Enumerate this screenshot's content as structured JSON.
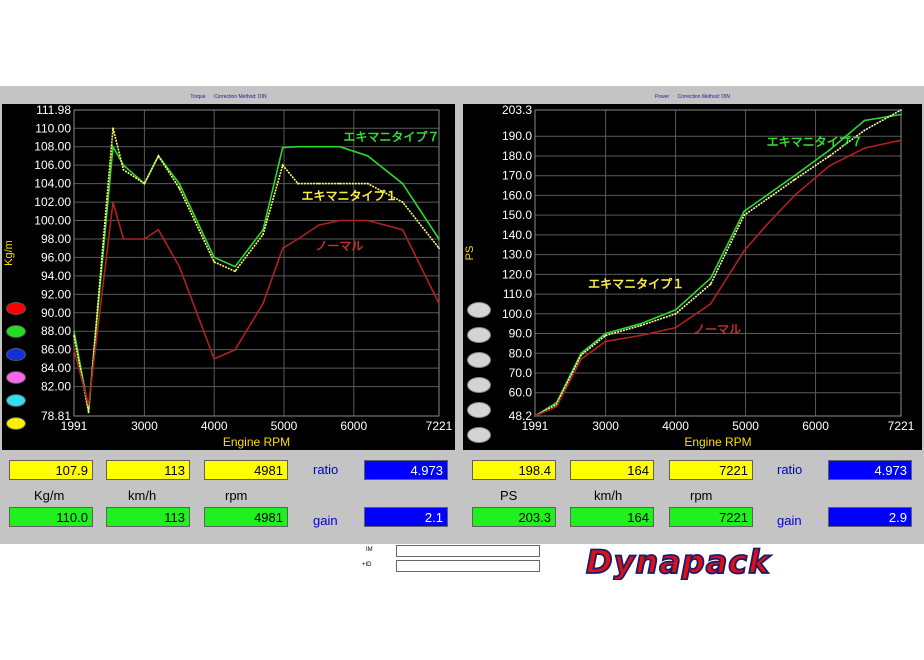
{
  "torque": {
    "title_left": "Torque",
    "title_right": "Correction Method: DIN",
    "y_label": "Kg/m",
    "x_label": "Engine RPM",
    "y_ticks": [
      "111.98",
      "110.00",
      "108.00",
      "106.00",
      "104.00",
      "102.00",
      "100.00",
      "98.00",
      "96.00",
      "94.00",
      "92.00",
      "90.00",
      "88.00",
      "86.00",
      "84.00",
      "82.00",
      "78.81"
    ],
    "x_ticks": [
      "1991",
      "3000",
      "4000",
      "5000",
      "6000",
      "7221"
    ],
    "labels": {
      "ex7": "エキマニタイプ７",
      "ex1": "エキマニタイプ１",
      "normal": "ノーマル"
    },
    "legend_colors": [
      "#ff0000",
      "#22dd22",
      "#1030e0",
      "#ff66ee",
      "#33ddee",
      "#ffee00"
    ]
  },
  "power": {
    "title_left": "Power",
    "title_right": "Correction Method: DIN",
    "y_label": "PS",
    "x_label": "Engine RPM",
    "y_ticks": [
      "203.3",
      "190.0",
      "180.0",
      "170.0",
      "160.0",
      "150.0",
      "140.0",
      "130.0",
      "120.0",
      "110.0",
      "100.0",
      "90.0",
      "80.0",
      "70.0",
      "60.0",
      "48.2"
    ],
    "x_ticks": [
      "1991",
      "3000",
      "4000",
      "5000",
      "6000",
      "7221"
    ],
    "labels": {
      "ex1": "エキマニタイプ１",
      "ex7": "エキマニタイプ７",
      "normal": "ノーマル"
    }
  },
  "readouts_left": {
    "top": [
      "107.9",
      "113",
      "4981"
    ],
    "units": [
      "Kg/m",
      "km/h",
      "rpm"
    ],
    "bottom": [
      "110.0",
      "113",
      "4981"
    ],
    "ratio_label": "ratio",
    "ratio_value": "4.973",
    "gain_label": "gain",
    "gain_value": "2.1"
  },
  "readouts_right": {
    "top": [
      "198.4",
      "164",
      "7221"
    ],
    "units": [
      "PS",
      "km/h",
      "rpm"
    ],
    "bottom": [
      "203.3",
      "164",
      "7221"
    ],
    "ratio_label": "ratio",
    "ratio_value": "4.973",
    "gain_label": "gain",
    "gain_value": "2.9"
  },
  "footer": {
    "field1_label": "IM",
    "field2_label": "+ID",
    "logo": "Dynapack"
  },
  "chart_data": [
    {
      "type": "line",
      "title": "Torque",
      "xlabel": "Engine RPM",
      "ylabel": "Kg/m",
      "xlim": [
        1991,
        7221
      ],
      "ylim": [
        78.81,
        111.98
      ],
      "series": [
        {
          "name": "エキマニタイプ７",
          "color": "#2fd62f",
          "x": [
            1991,
            2200,
            2550,
            2700,
            3000,
            3200,
            3500,
            4000,
            4300,
            4700,
            4981,
            5200,
            5500,
            5800,
            6200,
            6700,
            7221
          ],
          "y": [
            88,
            79.5,
            108,
            106,
            104,
            107,
            104,
            96,
            95,
            99,
            107.9,
            108,
            108,
            108,
            107,
            104,
            98
          ]
        },
        {
          "name": "エキマニタイプ１",
          "color": "#ffff66",
          "x": [
            1991,
            2200,
            2550,
            2700,
            3000,
            3200,
            3500,
            4000,
            4300,
            4700,
            4981,
            5200,
            5500,
            5800,
            6200,
            6700,
            7221
          ],
          "y": [
            87.5,
            79.2,
            110,
            105.5,
            104,
            107,
            103.5,
            95.5,
            94.5,
            98.5,
            106,
            104,
            104,
            104,
            104,
            102,
            97
          ]
        },
        {
          "name": "ノーマル",
          "color": "#b02020",
          "x": [
            1991,
            2200,
            2550,
            2700,
            3000,
            3200,
            3500,
            4000,
            4300,
            4700,
            4981,
            5200,
            5500,
            5800,
            6200,
            6700,
            7221
          ],
          "y": [
            86,
            80,
            102,
            98,
            98,
            99,
            95,
            85,
            86,
            91,
            97,
            98,
            99.5,
            100,
            100,
            99,
            91
          ]
        }
      ]
    },
    {
      "type": "line",
      "title": "Power",
      "xlabel": "Engine RPM",
      "ylabel": "PS",
      "xlim": [
        1991,
        7221
      ],
      "ylim": [
        48.2,
        203.3
      ],
      "series": [
        {
          "name": "エキマニタイプ７",
          "color": "#2fd62f",
          "x": [
            1991,
            2300,
            2650,
            3000,
            3500,
            4000,
            4500,
            4981,
            5300,
            5700,
            6200,
            6700,
            7221
          ],
          "y": [
            48.2,
            55,
            80,
            90,
            95,
            102,
            118,
            152,
            160,
            170,
            183,
            198,
            201
          ]
        },
        {
          "name": "エキマニタイプ１",
          "color": "#ffffaa",
          "x": [
            1991,
            2300,
            2650,
            3000,
            3500,
            4000,
            4500,
            4981,
            5300,
            5700,
            6200,
            6700,
            7221
          ],
          "y": [
            48.2,
            54,
            79,
            89,
            94,
            100,
            115,
            150,
            158,
            168,
            180,
            193,
            203.3
          ]
        },
        {
          "name": "ノーマル",
          "color": "#b02020",
          "x": [
            1991,
            2300,
            2650,
            3000,
            3500,
            4000,
            4500,
            4981,
            5300,
            5700,
            6200,
            6700,
            7221
          ],
          "y": [
            48.2,
            53,
            77,
            86,
            89,
            93,
            105,
            132,
            145,
            160,
            175,
            184,
            188
          ]
        }
      ]
    }
  ]
}
